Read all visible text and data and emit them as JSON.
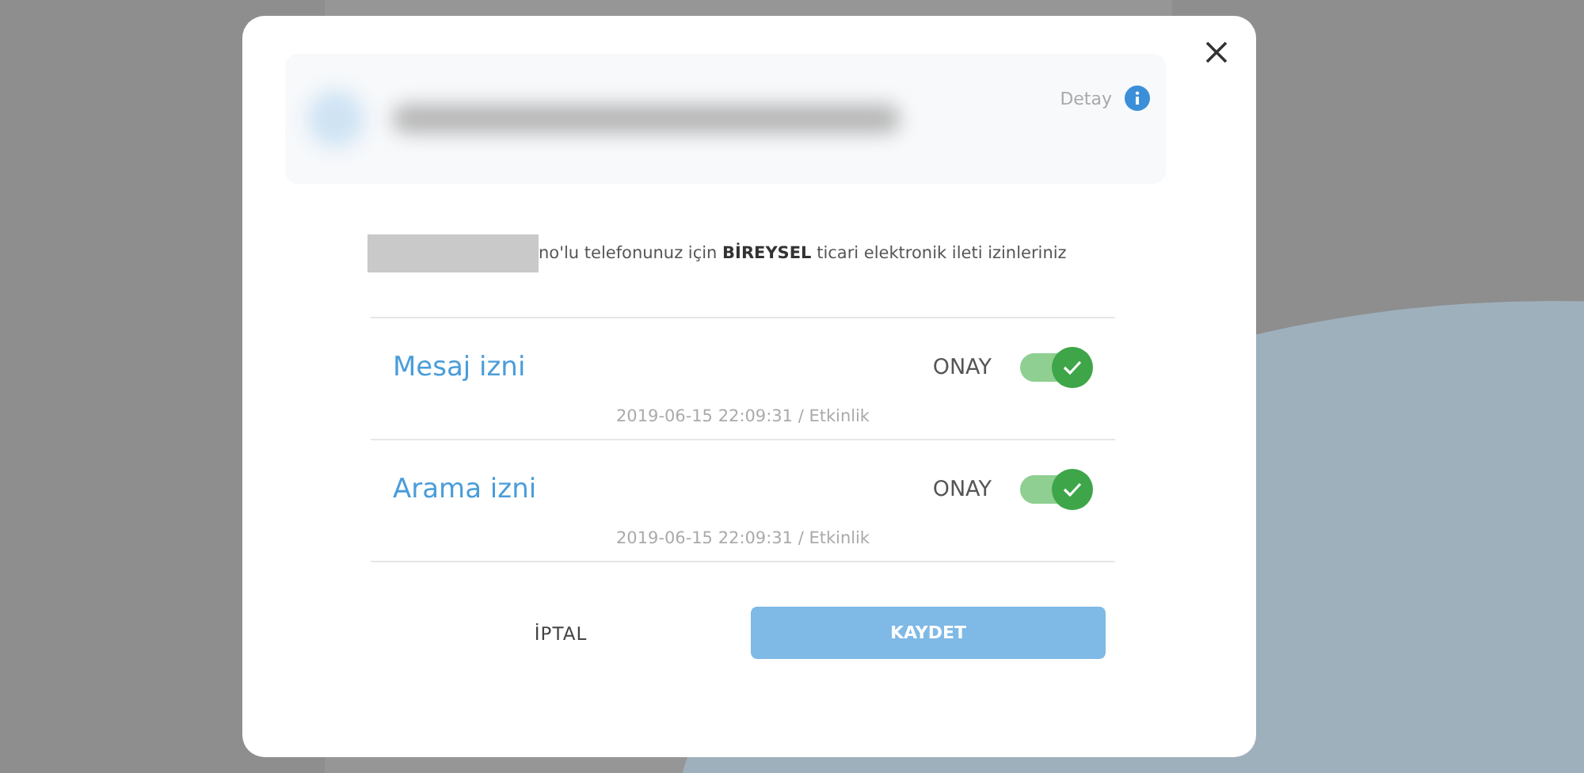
{
  "detail_card": {
    "link": "Detay"
  },
  "intro": "no'lu telefonunuz için **BİREYSEL** ticari elektronik ileti izinleriniz",
  "permissions": [
    {
      "title": "Mesaj izni",
      "status": "ONAY",
      "on": true,
      "date": "2019-06-15 22:09:31 / Etkinlik"
    },
    {
      "title": "Arama izni",
      "status": "ONAY",
      "on": true,
      "date": "2019-06-15 22:09:31 / Etkinlik"
    }
  ],
  "buttons": {
    "cancel": "İPTAL",
    "save": "KAYDET"
  }
}
